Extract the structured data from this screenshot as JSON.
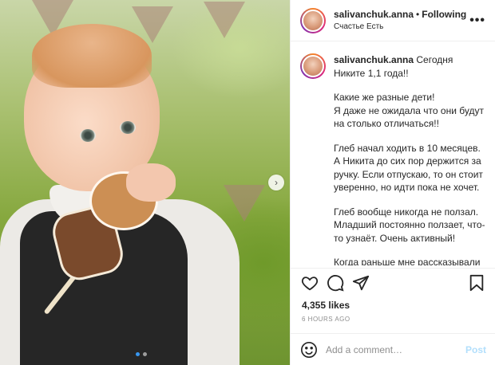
{
  "post": {
    "username": "salivanchuk.anna",
    "follow_separator": "•",
    "follow_status": "Following",
    "location": "Счастье Есть",
    "more_label": "•••",
    "carousel_next_glyph": "›",
    "caption": {
      "first_line": "Сегодня Никите 1,1 года!!",
      "paragraphs": [
        "Какие же разные дети!\nЯ даже не ожидала что они будут на столько отличаться!!",
        "Глеб начал ходить в 10 месяцев. А Никита до сих пор держится за ручку. Если отпускаю, то он стоит уверенно, но идти пока не хочет.",
        "Глеб вообще никогда не ползал. Младший постоянно ползает, что-то узнаёт. Очень активный!",
        "Когда раньше мне рассказывали знакомые мамочки, что не могут постричь ногти ребёнку, я думала:"
      ]
    },
    "likes": "4,355 likes",
    "time": "6 HOURS AGO",
    "comment_placeholder": "Add a comment…",
    "post_button": "Post"
  },
  "icons": {
    "like": "heart-icon",
    "comment": "comment-icon",
    "share": "paper-plane-icon",
    "save": "bookmark-icon",
    "emoji": "smiley-icon",
    "more": "more-horizontal-icon"
  },
  "colors": {
    "text": "#262626",
    "secondary": "#8e8e8e",
    "border": "#efefef",
    "link_blue": "#3897f0",
    "post_disabled": "#b2dffc"
  },
  "carousel": {
    "total": 2,
    "active_index": 0
  }
}
